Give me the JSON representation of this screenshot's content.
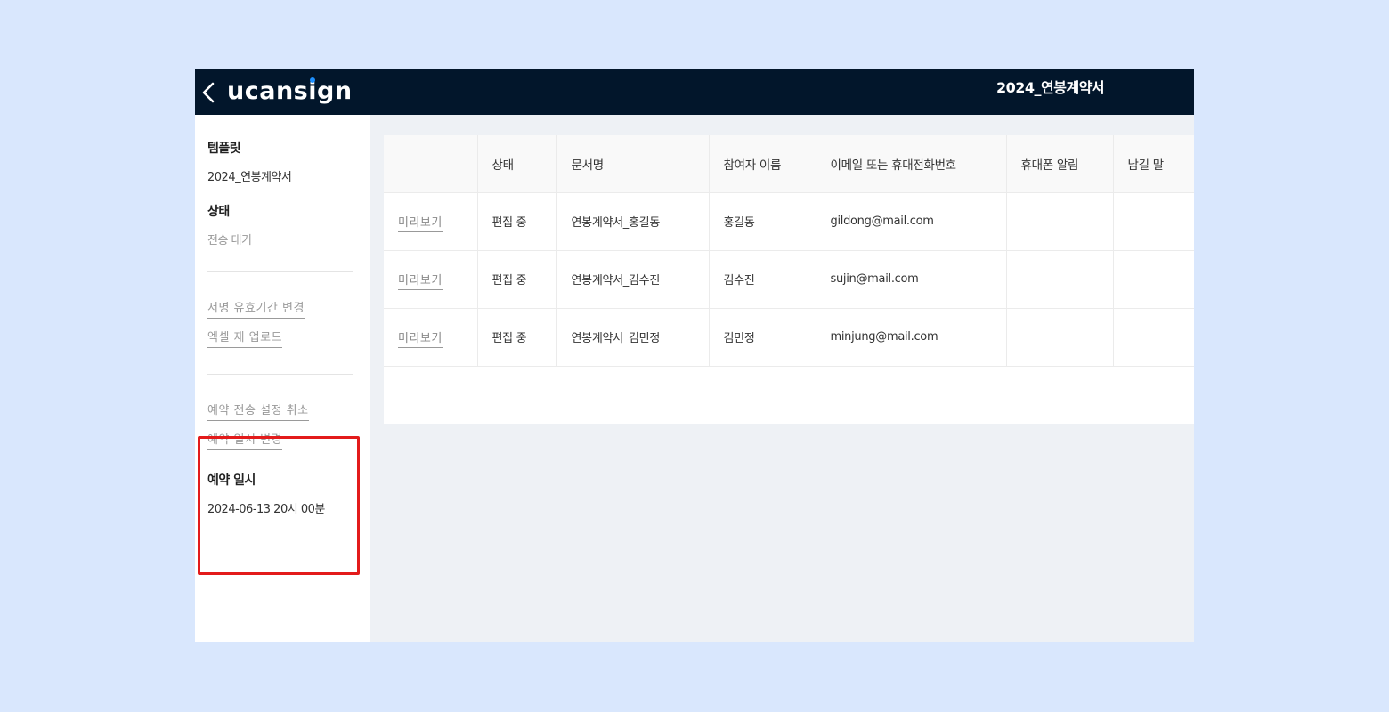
{
  "header": {
    "logo_text": "ucansign",
    "document_title": "2024_연봉계약서"
  },
  "sidebar": {
    "template_label": "템플릿",
    "template_value": "2024_연봉계약서",
    "status_label": "상태",
    "status_value": "전송 대기",
    "links_group1": [
      "서명 유효기간 변경",
      "엑셀 재 업로드"
    ],
    "links_group2": [
      "예약 전송 설정 취소",
      "예약 일시 변경"
    ],
    "reservation_label": "예약 일시",
    "reservation_value": "2024-06-13 20시 00분"
  },
  "table": {
    "columns": [
      "",
      "상태",
      "문서명",
      "참여자 이름",
      "이메일 또는 휴대전화번호",
      "휴대폰 알림",
      "남길 말"
    ],
    "rows": [
      {
        "preview": "미리보기",
        "status": "편집 중",
        "doc_name": "연봉계약서_홍길동",
        "name": "홍길동",
        "contact": "gildong@mail.com",
        "sms": "",
        "message": ""
      },
      {
        "preview": "미리보기",
        "status": "편집 중",
        "doc_name": "연봉계약서_김수진",
        "name": "김수진",
        "contact": "sujin@mail.com",
        "sms": "",
        "message": ""
      },
      {
        "preview": "미리보기",
        "status": "편집 중",
        "doc_name": "연봉계약서_김민정",
        "name": "김민정",
        "contact": "minjung@mail.com",
        "sms": "",
        "message": ""
      }
    ]
  },
  "colors": {
    "header_bg": "#02162b",
    "page_bg": "#d9e7fd",
    "highlight_border": "#e31b1b",
    "logo_dot": "#1e90ff"
  },
  "icons": {
    "back": "chevron-left-icon"
  }
}
